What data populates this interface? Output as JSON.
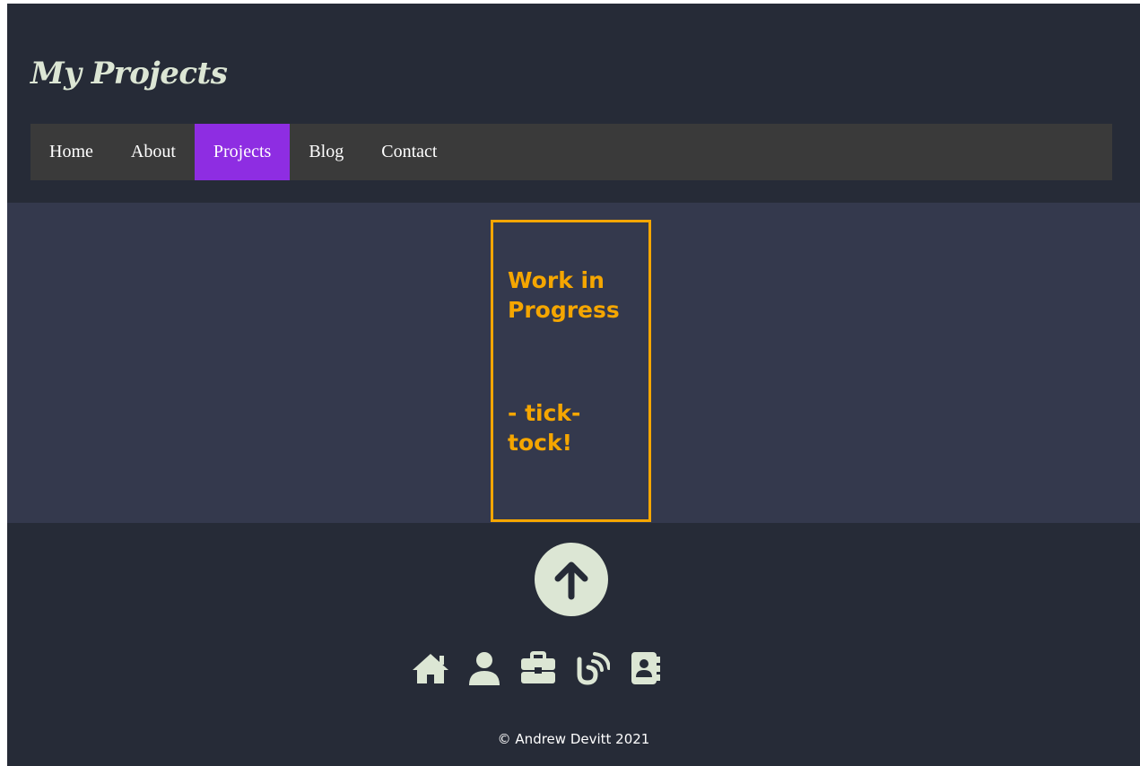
{
  "header": {
    "title": "My Projects"
  },
  "nav": {
    "items": [
      {
        "label": "Home",
        "active": false
      },
      {
        "label": "About",
        "active": false
      },
      {
        "label": "Projects",
        "active": true
      },
      {
        "label": "Blog",
        "active": false
      },
      {
        "label": "Contact",
        "active": false
      }
    ]
  },
  "main": {
    "notice_line1": "Work in Progress",
    "notice_line2": "- tick-tock!"
  },
  "footer": {
    "scroll_top_icon": "arrow-up-circle-icon",
    "icons": [
      "home-icon",
      "user-icon",
      "briefcase-icon",
      "blog-feed-icon",
      "contact-book-icon"
    ],
    "copyright": "© Andrew Devitt 2021"
  },
  "colors": {
    "background": "#262b37",
    "content": "#34394d",
    "nav_bar": "#3a3a3a",
    "nav_active": "#8e2de2",
    "accent_orange": "#f5a600",
    "icon_light": "#dce6d4"
  }
}
